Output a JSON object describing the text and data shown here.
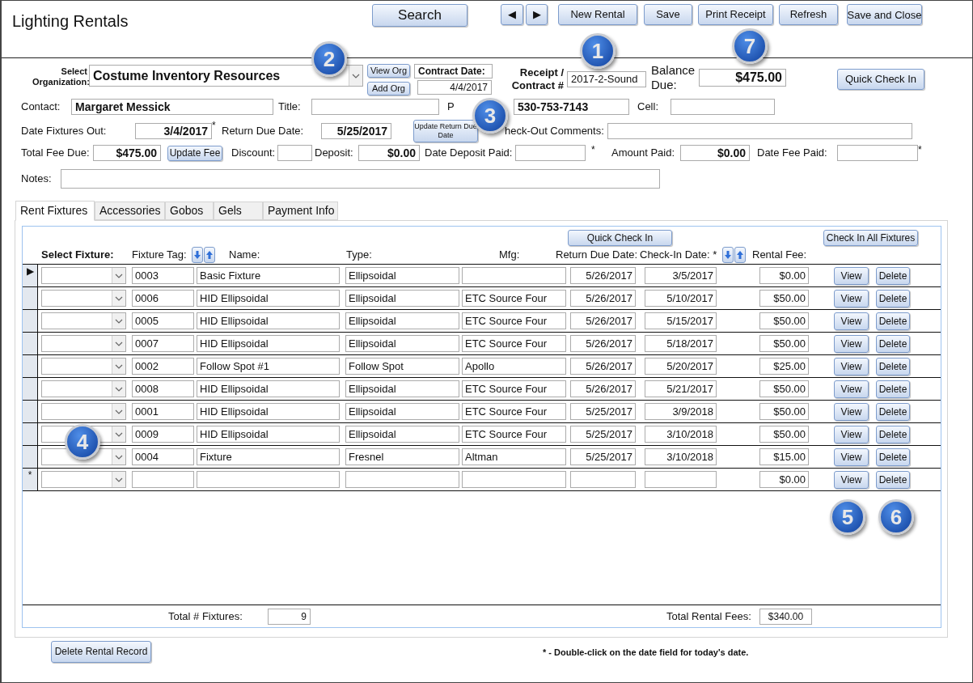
{
  "title": "Lighting Rentals",
  "toolbar": {
    "search": "Search",
    "prev": "◀",
    "next": "▶",
    "buttons": [
      "New Rental",
      "Save",
      "Print Receipt",
      "Refresh",
      "Save and Close"
    ]
  },
  "callouts": [
    "1",
    "2",
    "3",
    "4",
    "5",
    "6",
    "7"
  ],
  "organization": {
    "label": "Select Organization:",
    "value": "Costume Inventory Resources",
    "view_button": "View Org",
    "add_button": "Add Org"
  },
  "contract_date": {
    "label": "Contract Date:",
    "value": "4/4/2017"
  },
  "receipt": {
    "label": "Receipt / Contract #",
    "value": "2017-2-Sound"
  },
  "balance_due": {
    "label": "Balance Due:",
    "value": "$475.00"
  },
  "quick_check_in": "Quick Check In",
  "form_rows": [
    [
      {
        "kind": "label",
        "text": "Contact:"
      },
      {
        "kind": "field",
        "value": "Margaret Messick"
      },
      {
        "kind": "label",
        "text": "Title:"
      },
      {
        "kind": "field"
      },
      {
        "kind": "label",
        "text": "P"
      },
      {
        "kind": "field",
        "value": "530-753-7143"
      },
      {
        "kind": "label",
        "text": "Cell:"
      },
      {
        "kind": "field"
      }
    ],
    [
      {
        "kind": "label",
        "text": "Date Fixtures Out:"
      },
      {
        "kind": "field",
        "value": "3/4/2017"
      },
      {
        "kind": "mark",
        "text": "*"
      },
      {
        "kind": "label",
        "text": "Return Due Date:"
      },
      {
        "kind": "field",
        "value": "5/25/2017"
      },
      {
        "kind": "button",
        "text": "Update Return Due Date"
      },
      {
        "kind": "label",
        "text": "heck-Out Comments:"
      },
      {
        "kind": "field"
      }
    ],
    [
      {
        "kind": "label",
        "text": "Total Fee Due:"
      },
      {
        "kind": "field",
        "value": "$475.00"
      },
      {
        "kind": "button",
        "text": "Update Fee"
      },
      {
        "kind": "label",
        "text": "Discount:"
      },
      {
        "kind": "field"
      },
      {
        "kind": "label",
        "text": "Deposit:"
      },
      {
        "kind": "field",
        "value": "$0.00"
      },
      {
        "kind": "label",
        "text": "Date Deposit Paid:"
      },
      {
        "kind": "field"
      },
      {
        "kind": "mark",
        "text": "*"
      },
      {
        "kind": "label",
        "text": "Amount Paid:"
      },
      {
        "kind": "field",
        "value": "$0.00"
      },
      {
        "kind": "label",
        "text": "Date Fee Paid:"
      },
      {
        "kind": "field"
      },
      {
        "kind": "mark",
        "text": "*"
      }
    ],
    [
      {
        "kind": "label",
        "text": "Notes:"
      },
      {
        "kind": "field"
      }
    ]
  ],
  "tabs": [
    {
      "label": "Rent Fixtures",
      "selected": true
    },
    {
      "label": "Accessories",
      "selected": false
    },
    {
      "label": "Gobos",
      "selected": false
    },
    {
      "label": "Gels",
      "selected": false
    },
    {
      "label": "Payment Info",
      "selected": false
    }
  ],
  "fixtures": {
    "quick_check_in": "Quick Check In",
    "check_in_all": "Check In All Fixtures",
    "columns": [
      "Select Fixture:",
      "Fixture Tag:",
      "Name:",
      "Type:",
      "Mfg:",
      "Return Due Date:",
      "Check-In Date: *",
      "Rental Fee:"
    ],
    "rows": [
      {
        "selector": "▶",
        "tag": "0003",
        "name": "Basic Fixture",
        "type": "Ellipsoidal",
        "return_due": "5/26/2017",
        "check_in": "3/5/2017",
        "fee": "$0.00",
        "view": "View",
        "delete": "Delete"
      },
      {
        "tag": "0006",
        "name": "HID Ellipsoidal",
        "type": "Ellipsoidal",
        "mfg": "ETC Source Four",
        "return_due": "5/26/2017",
        "check_in": "5/10/2017",
        "fee": "$50.00",
        "view": "View",
        "delete": "Delete"
      },
      {
        "tag": "0005",
        "name": "HID Ellipsoidal",
        "type": "Ellipsoidal",
        "mfg": "ETC Source Four",
        "return_due": "5/26/2017",
        "check_in": "5/15/2017",
        "fee": "$50.00",
        "view": "View",
        "delete": "Delete"
      },
      {
        "tag": "0007",
        "name": "HID Ellipsoidal",
        "type": "Ellipsoidal",
        "mfg": "ETC Source Four",
        "return_due": "5/26/2017",
        "check_in": "5/18/2017",
        "fee": "$50.00",
        "view": "View",
        "delete": "Delete"
      },
      {
        "tag": "0002",
        "name": "Follow Spot #1",
        "type": "Follow Spot",
        "mfg": "Apollo",
        "return_due": "5/26/2017",
        "check_in": "5/20/2017",
        "fee": "$25.00",
        "view": "View",
        "delete": "Delete"
      },
      {
        "tag": "0008",
        "name": "HID Ellipsoidal",
        "type": "Ellipsoidal",
        "mfg": "ETC Source Four",
        "return_due": "5/26/2017",
        "check_in": "5/21/2017",
        "fee": "$50.00",
        "view": "View",
        "delete": "Delete"
      },
      {
        "tag": "0001",
        "name": "HID Ellipsoidal",
        "type": "Ellipsoidal",
        "mfg": "ETC Source Four",
        "return_due": "5/25/2017",
        "check_in": "3/9/2018",
        "fee": "$50.00",
        "view": "View",
        "delete": "Delete"
      },
      {
        "tag": "0009",
        "name": "HID Ellipsoidal",
        "type": "Ellipsoidal",
        "mfg": "ETC Source Four",
        "return_due": "5/25/2017",
        "check_in": "3/10/2018",
        "fee": "$50.00",
        "view": "View",
        "delete": "Delete"
      },
      {
        "tag": "0004",
        "name": "Fixture",
        "type": "Fresnel",
        "mfg": "Altman",
        "return_due": "5/25/2017",
        "check_in": "3/10/2018",
        "fee": "$15.00",
        "view": "View",
        "delete": "Delete"
      },
      {
        "selector": "*",
        "fee": "$0.00",
        "view": "View",
        "delete": "Delete"
      }
    ],
    "total_count_label": "Total # Fixtures:",
    "total_count": "9",
    "total_fees_label": "Total Rental Fees:",
    "total_fees": "$340.00"
  },
  "delete_record": "Delete Rental Record",
  "footnote": "* - Double-click on the date field for today's date."
}
